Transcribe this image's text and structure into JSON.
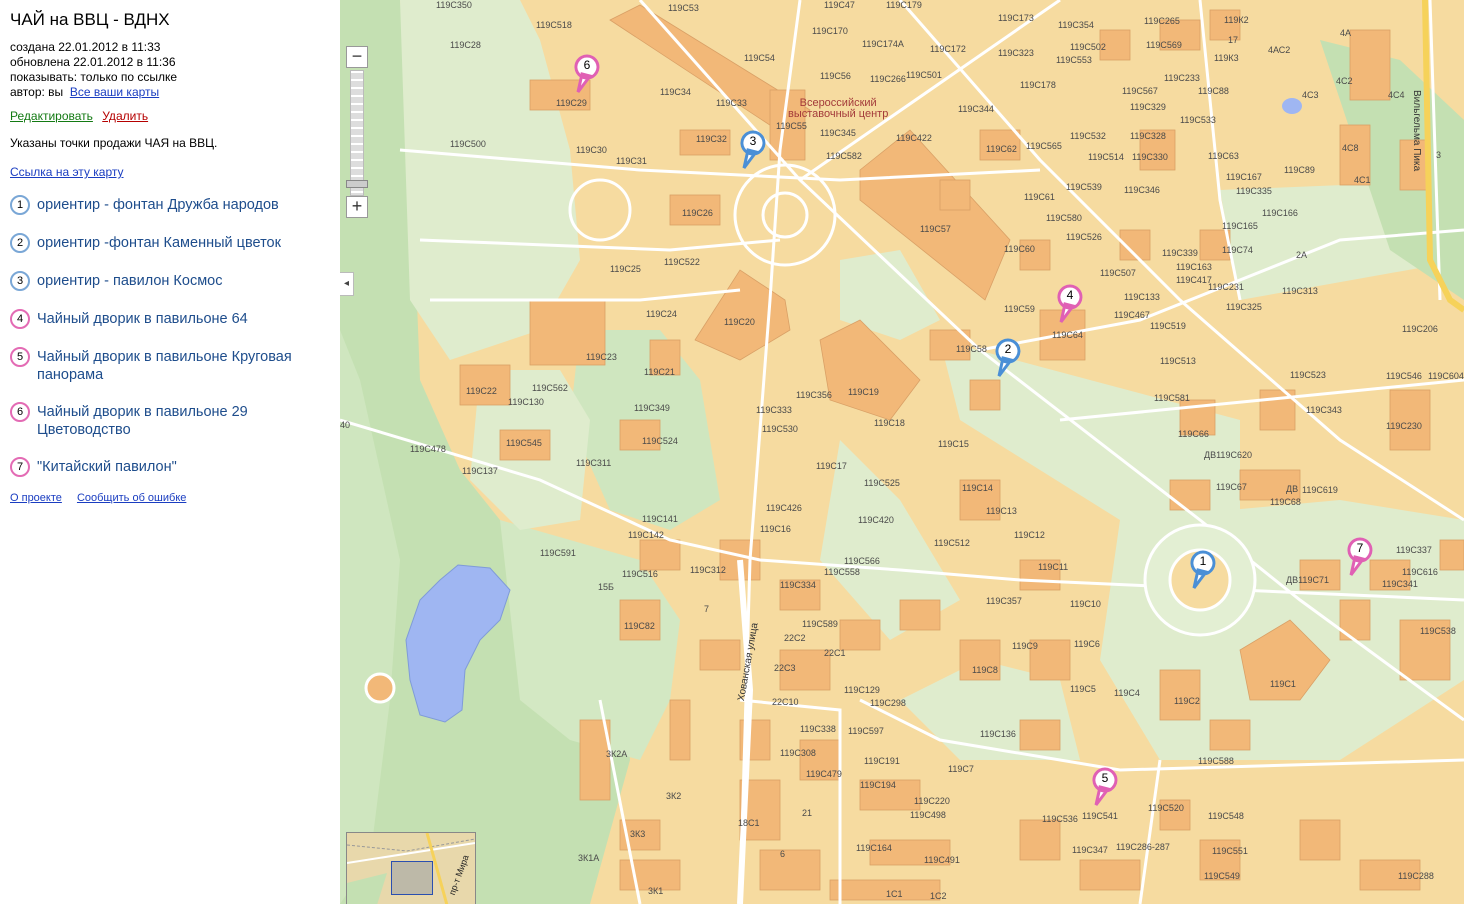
{
  "sidebar": {
    "title": "ЧАЙ на ВВЦ - ВДНХ",
    "created": "создана 22.01.2012 в 11:33",
    "updated": "обновлена 22.01.2012 в 11:36",
    "visibility": "показывать: только по ссылке",
    "author_prefix": "автор: вы",
    "all_maps_link": "Все ваши карты",
    "edit_link": "Редактировать",
    "delete_link": "Удалить",
    "description": "Указаны точки продажи ЧАЯ на ВВЦ.",
    "map_link": "Ссылка на эту карту",
    "points": [
      {
        "num": "1",
        "label": "ориентир - фонтан Дружба народов"
      },
      {
        "num": "2",
        "label": "ориентир -фонтан Каменный цветок"
      },
      {
        "num": "3",
        "label": "ориентир - павилон Космос"
      },
      {
        "num": "4",
        "label": "Чайный дворик в павильоне 64"
      },
      {
        "num": "5",
        "label": "Чайный дворик в павильоне Круговая панорама"
      },
      {
        "num": "6",
        "label": "Чайный дворик в павильоне 29 Цветоводство"
      },
      {
        "num": "7",
        "label": "\"Китайский павилон\""
      }
    ],
    "footer_about": "О проекте",
    "footer_report": "Сообщить об ошибке"
  },
  "map": {
    "zoom_out": "−",
    "zoom_in": "+",
    "collapse": "◂",
    "center_label_1": "Всероссийский",
    "center_label_2": "выставочный центр",
    "street_1": "Хованская улица",
    "street_2": "Вильгельма Пика",
    "minimap_street": "пр-т Мира",
    "labels": {
      "l1": "119С350",
      "l2": "119С53",
      "l3": "119С47",
      "l4": "119С179",
      "l5": "119С173",
      "l6": "119С354",
      "l7": "119С265",
      "l8": "119К2",
      "l9": "4А",
      "l10": "119С518",
      "l11": "119С28",
      "l12": "119С170",
      "l13": "119С174А",
      "l14": "119С172",
      "l15": "119С323",
      "l16": "119С502",
      "l17": "119С553",
      "l18": "119С569",
      "l19": "17",
      "l20": "4АС2",
      "l21": "119К3",
      "l22": "119С54",
      "l23": "119С56",
      "l24": "119С266",
      "l25": "119С501",
      "l26": "119С178",
      "l27": "119С233",
      "l28": "119С567",
      "l29": "119С88",
      "l30": "4С2",
      "l31": "4С3",
      "l32": "4С4",
      "l33": "119С34",
      "l34": "119С29",
      "l35": "119С33",
      "l36": "119С55",
      "l37": "119С344",
      "l38": "119С329",
      "l39": "119С533",
      "l40": "119С32",
      "l41": "119С345",
      "l42": "119С422",
      "l43": "119С532",
      "l44": "119С328",
      "l45": "119С500",
      "l46": "119С30",
      "l47": "119С31",
      "l48": "119С582",
      "l49": "119С62",
      "l50": "119С565",
      "l51": "119С514",
      "l52": "119С330",
      "l53": "119С63",
      "l54": "4С8",
      "l55": "3",
      "l56": "119С89",
      "l57": "4С1",
      "l58": "119С539",
      "l59": "119С346",
      "l60": "119С167",
      "l61": "119С335",
      "l62": "119С61",
      "l63": "119С26",
      "l64": "119С580",
      "l65": "119С166",
      "l66": "119С165",
      "l67": "119С57",
      "l68": "119С526",
      "l69": "119С60",
      "l70": "119С339",
      "l71": "119С74",
      "l72": "2А",
      "l73": "119С25",
      "l74": "119С522",
      "l75": "119С163",
      "l76": "119С417",
      "l77": "119С507",
      "l78": "119С231",
      "l79": "119С313",
      "l80": "119С133",
      "l81": "119С325",
      "l82": "119С24",
      "l83": "119С20",
      "l84": "119С59",
      "l85": "119С467",
      "l86": "119С519",
      "l87": "119С206",
      "l88": "119С64",
      "l89": "119С58",
      "l90": "119С513",
      "l91": "119С23",
      "l92": "119С21",
      "l93": "119С19",
      "l94": "119С356",
      "l95": "119С523",
      "l96": "119С546",
      "l97": "119С604",
      "l98": "119С22",
      "l99": "119С562",
      "l100": "119С130",
      "l101": "119С581",
      "l102": "119С343",
      "l103": "119С349",
      "l104": "119С333",
      "l105": "119С18",
      "l106": "119С66",
      "l107": "119С230",
      "l108": "119С530",
      "l109": "119С15",
      "l110": "119С545",
      "l111": "119С524",
      "l112": "119С478",
      "l113": "ДВ119С620",
      "l114": "119С311",
      "l115": "119С17",
      "l116": "119С137",
      "l117": "119С525",
      "l118": "119С14",
      "l119": "119С67",
      "l120": "ДВ",
      "l121": "119С619",
      "l122": "119С68",
      "l123": "119С426",
      "l124": "119С13",
      "l125": "119С141",
      "l126": "119С420",
      "l127": "119С16",
      "l128": "119С142",
      "l129": "119С12",
      "l130": "119С512",
      "l131": "119С337",
      "l132": "119С591",
      "l133": "119С566",
      "l134": "119С558",
      "l135": "119С11",
      "l136": "ДВ119С71",
      "l137": "119С616",
      "l138": "119С341",
      "l139": "119С312",
      "l140": "119С516",
      "l141": "15Б",
      "l142": "119С334",
      "l143": "119С357",
      "l144": "119С10",
      "l145": "7",
      "l146": "119С82",
      "l147": "119С589",
      "l148": "119С538",
      "l149": "22С2",
      "l150": "22С1",
      "l151": "119С9",
      "l152": "119С6",
      "l153": "22С3",
      "l154": "119С8",
      "l155": "119С1",
      "l156": "119С129",
      "l157": "119С5",
      "l158": "119С4",
      "l159": "22С10",
      "l160": "119С298",
      "l161": "119С2",
      "l162": "119С338",
      "l163": "119С597",
      "l164": "119С136",
      "l165": "3К2А",
      "l166": "119С308",
      "l167": "119С191",
      "l168": "119С588",
      "l169": "119С479",
      "l170": "119С7",
      "l171": "119С194",
      "l172": "3К2",
      "l173": "119С220",
      "l174": "119С520",
      "l175": "119С498",
      "l176": "119С548",
      "l177": "21",
      "l178": "119С536",
      "l179": "119С541",
      "l180": "18С1",
      "l181": "3К3",
      "l182": "119С164",
      "l183": "119С347",
      "l184": "119С286-287",
      "l185": "119С551",
      "l186": "6",
      "l187": "3К1А",
      "l188": "119С491",
      "l189": "119С549",
      "l190": "119С288",
      "l191": "3К1",
      "l192": "1С1",
      "l193": "1С2",
      "l194": "40"
    },
    "markers": [
      "1",
      "2",
      "3",
      "4",
      "5",
      "6",
      "7"
    ]
  },
  "colors": {
    "land": "#f6dba0",
    "building": "#f2b878",
    "park": "#dfeccd",
    "forest": "#c4e0b2",
    "water": "#9fb6f2",
    "road": "#ffffff",
    "marker_blue": "#4a8fd6",
    "marker_pink": "#e060b4"
  }
}
